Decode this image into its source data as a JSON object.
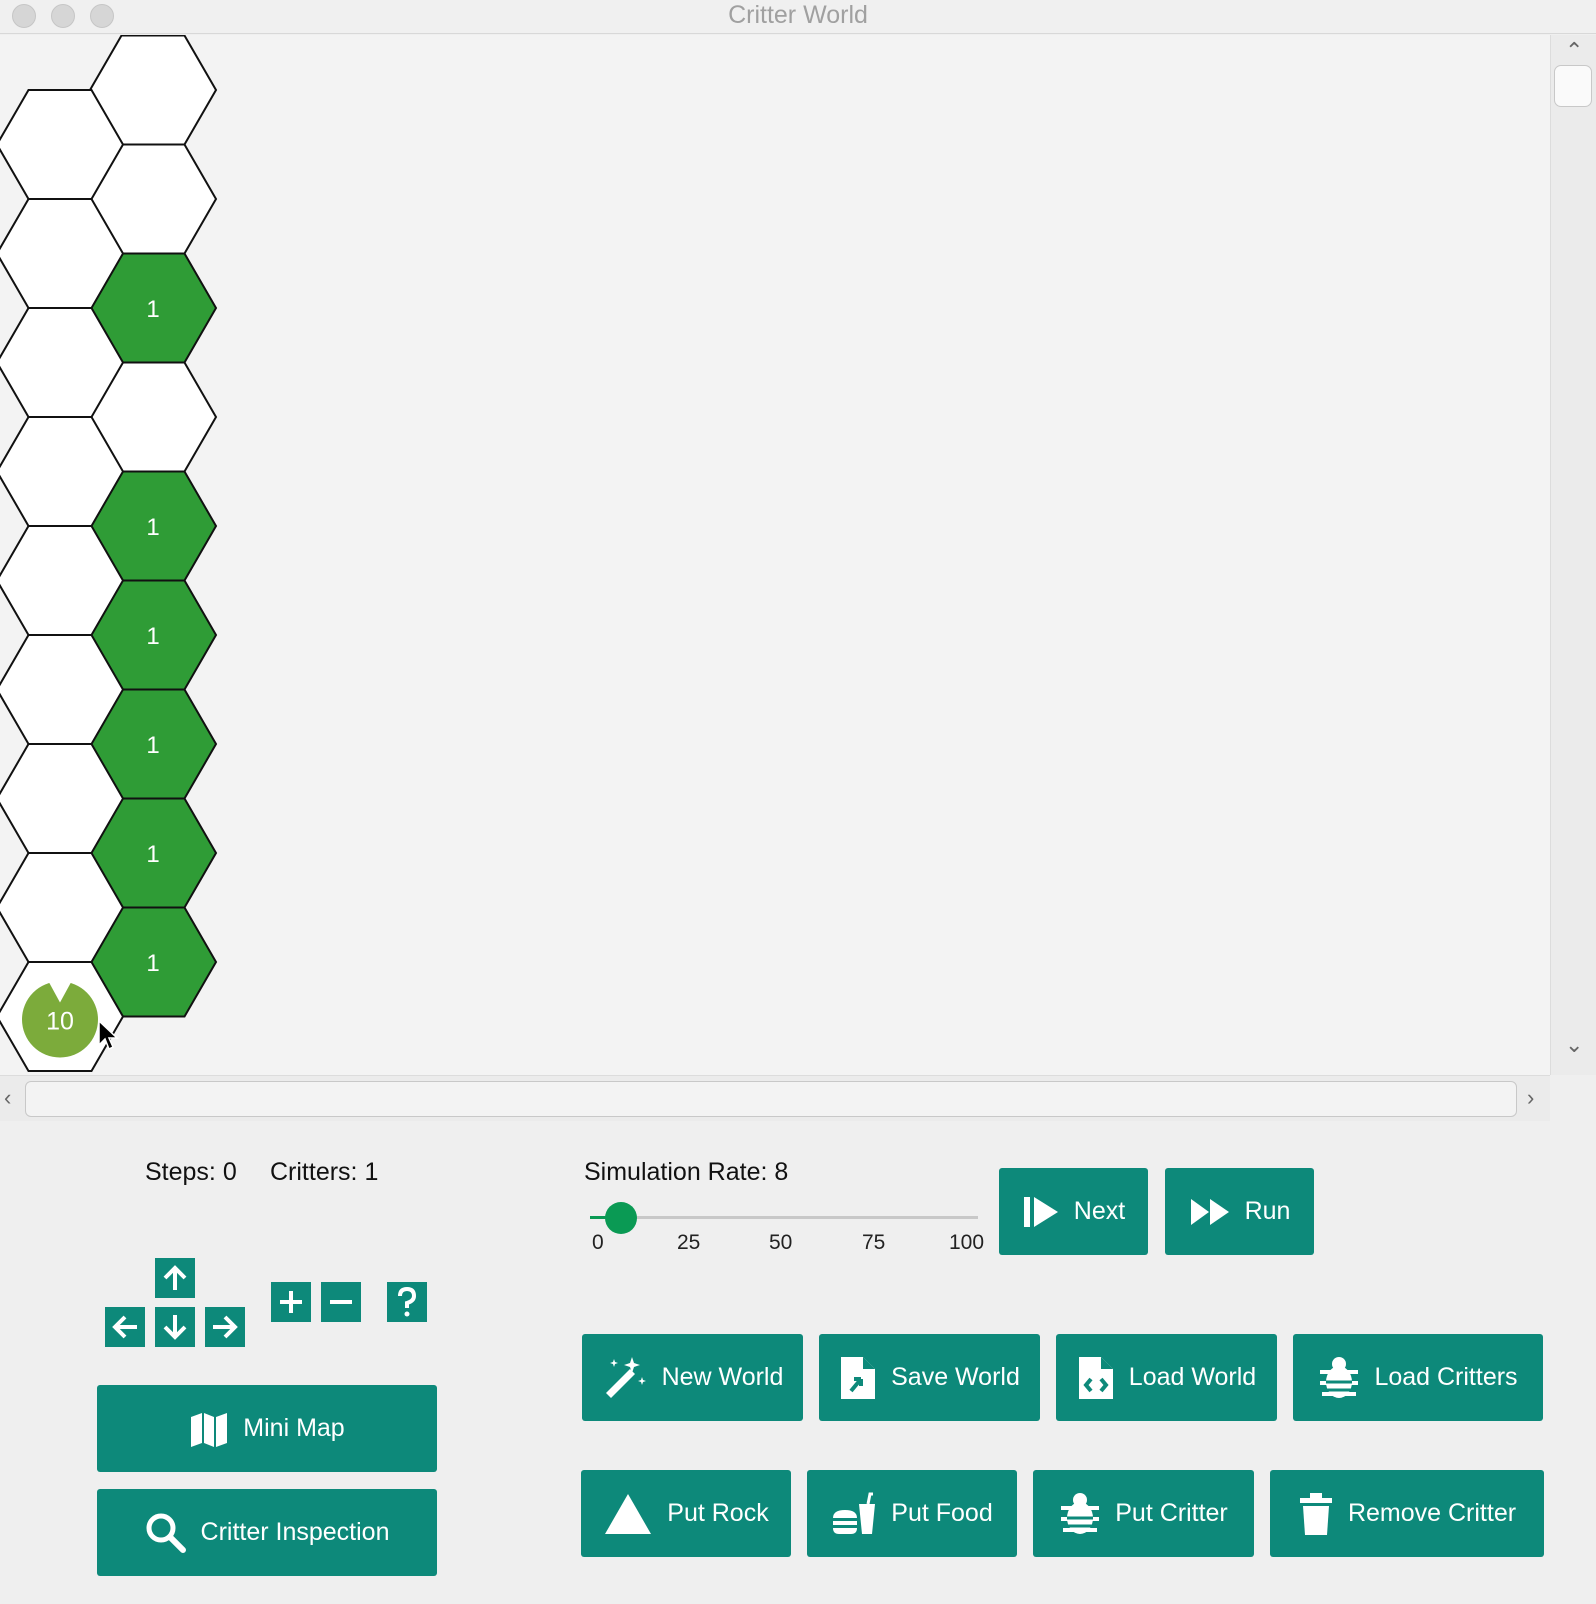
{
  "window": {
    "title": "Critter World"
  },
  "world": {
    "food_label": "1",
    "critter_label": "10",
    "cells": [
      {
        "col": 1,
        "row": 0,
        "type": "empty"
      },
      {
        "col": 1,
        "row": 1,
        "type": "empty"
      },
      {
        "col": 1,
        "row": 2,
        "type": "food"
      },
      {
        "col": 1,
        "row": 3,
        "type": "empty"
      },
      {
        "col": 1,
        "row": 4,
        "type": "food"
      },
      {
        "col": 1,
        "row": 5,
        "type": "food"
      },
      {
        "col": 1,
        "row": 6,
        "type": "food"
      },
      {
        "col": 1,
        "row": 7,
        "type": "food"
      },
      {
        "col": 1,
        "row": 8,
        "type": "food"
      },
      {
        "col": 0,
        "row": 0,
        "type": "empty"
      },
      {
        "col": 0,
        "row": 1,
        "type": "empty"
      },
      {
        "col": 0,
        "row": 2,
        "type": "empty"
      },
      {
        "col": 0,
        "row": 3,
        "type": "empty"
      },
      {
        "col": 0,
        "row": 4,
        "type": "empty"
      },
      {
        "col": 0,
        "row": 5,
        "type": "empty"
      },
      {
        "col": 0,
        "row": 6,
        "type": "empty"
      },
      {
        "col": 0,
        "row": 7,
        "type": "empty"
      },
      {
        "col": 0,
        "row": 8,
        "type": "critter"
      }
    ],
    "colors": {
      "food": "#2f9c36",
      "empty": "#ffffff",
      "critter": "#7cab3b"
    }
  },
  "status": {
    "steps": "Steps: 0",
    "critters": "Critters: 1"
  },
  "rate": {
    "label": "Simulation Rate: 8",
    "value": 8,
    "ticks": [
      "0",
      "25",
      "50",
      "75",
      "100"
    ]
  },
  "controls": {
    "next": "Next",
    "run": "Run",
    "new_world": "New World",
    "save_world": "Save World",
    "load_world": "Load World",
    "load_critters": "Load Critters",
    "put_rock": "Put Rock",
    "put_food": "Put Food",
    "put_critter": "Put Critter",
    "remove_critter": "Remove Critter",
    "mini_map": "Mini Map",
    "critter_inspection": "Critter Inspection"
  }
}
